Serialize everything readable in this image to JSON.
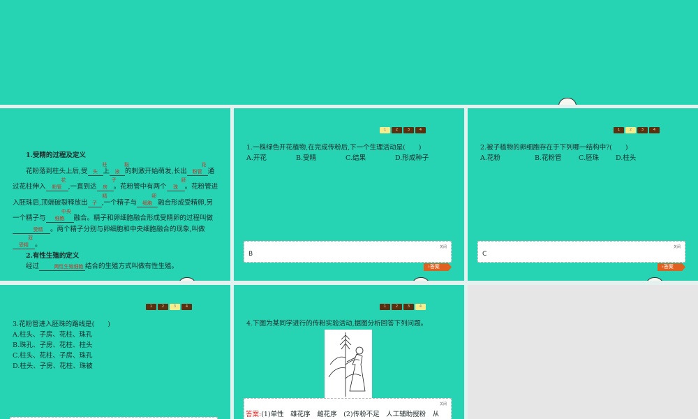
{
  "slide1": {
    "heading1": "1.受精的过程及定义",
    "p": [
      "花粉落到柱头上后,受",
      "上",
      "的刺激开始萌发,长出",
      "通过花柱伸入",
      "一直到达",
      "。花粉管中有两个",
      "。花粉管进入胚珠后,顶端破裂释放出",
      "一个精子与",
      "融合形成受精卵,另一个精子与",
      "融合。精子和卵细胞融合形成受精卵的过程叫做",
      "。两个精子分别与卵细胞和中央细胞融合的现象,叫做",
      "。"
    ],
    "blanks": [
      "柱头",
      "黏液",
      "花粉管",
      "花粉管",
      "子房",
      "胚珠",
      "精子",
      "卵细胞",
      "中央细胞",
      "受精",
      "双受精"
    ],
    "heading2": "2.有性生殖的定义",
    "p2a": "经过",
    "p2blank": "两性生殖细胞",
    "p2b": "结合的生殖方式叫做有性生殖。"
  },
  "nav": [
    "1",
    "2",
    "3",
    "4"
  ],
  "slide2": {
    "question": "1.一株绿色开花植物,在完成传粉后,下一个生理活动是(　　)",
    "options": [
      "A.开花",
      "B.受精",
      "C.结果",
      "D.形成种子"
    ],
    "close": "关闭",
    "answer": "B",
    "answer_button": "答案"
  },
  "slide3": {
    "question": "2.被子植物的卵细胞存在于下列哪一结构中?(　　)",
    "options": [
      "A.花粉",
      "B.花粉管",
      "C.胚珠",
      "D.柱头"
    ],
    "close": "关闭",
    "answer": "C",
    "answer_button": "答案"
  },
  "slide4": {
    "question": "3.花粉管进入胚珠的路线是(　　)",
    "options": [
      "A.柱头、子房、花柱、珠孔",
      "B.珠孔、子房、花柱、柱头",
      "C.柱头、花柱、子房、珠孔",
      "D.柱头、子房、花柱、珠被"
    ]
  },
  "slide5": {
    "question": "4.下图为某同学进行的传粉实验活动,据图分析回答下列问题。",
    "close": "关闭",
    "answer_label": "答案:",
    "answer_text": "(1)单性　雄花序　雌花序　(2)传粉不足　人工辅助授粉　从"
  }
}
